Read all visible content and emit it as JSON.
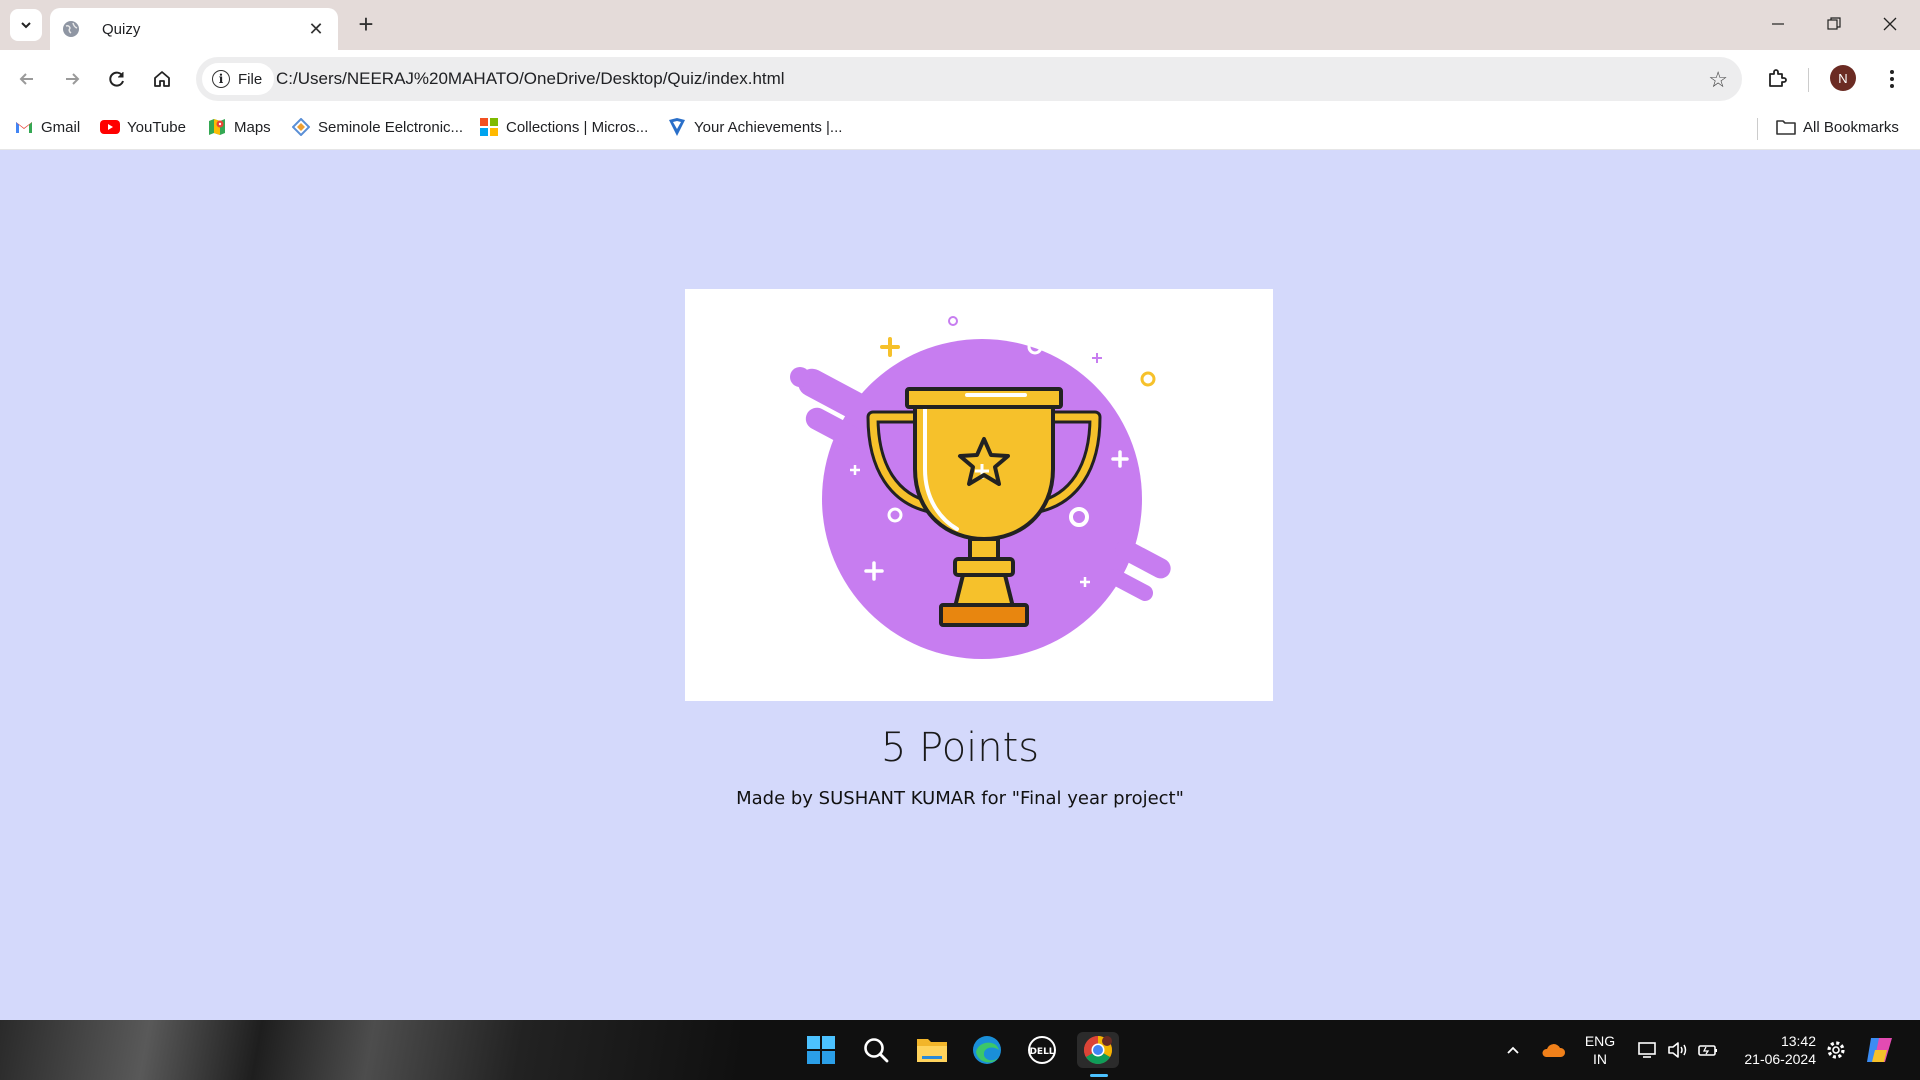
{
  "browser": {
    "tab": {
      "title": "Quizy"
    },
    "address": {
      "scheme_chip": "File",
      "url": "C:/Users/NEERAJ%20MAHATO/OneDrive/Desktop/Quiz/index.html"
    },
    "profile_initial": "N",
    "bookmarks": [
      {
        "label": "Gmail",
        "icon": "gmail-icon"
      },
      {
        "label": "YouTube",
        "icon": "youtube-icon"
      },
      {
        "label": "Maps",
        "icon": "maps-icon"
      },
      {
        "label": "Seminole Eelctronic...",
        "icon": "seminole-icon"
      },
      {
        "label": "Collections | Micros...",
        "icon": "microsoft-icon"
      },
      {
        "label": "Your Achievements |...",
        "icon": "achievements-icon"
      }
    ],
    "all_bookmarks": "All Bookmarks"
  },
  "page": {
    "score_text": "5 Points",
    "credit_text": "Made by SUSHANT KUMAR for \"Final year project\""
  },
  "taskbar": {
    "language": {
      "line1": "ENG",
      "line2": "IN"
    },
    "clock": {
      "time": "13:42",
      "date": "21-06-2024"
    }
  },
  "colors": {
    "page_background": "#d4d9fb",
    "trophy_blob": "#c77df0",
    "trophy_gold": "#f6c12b"
  }
}
